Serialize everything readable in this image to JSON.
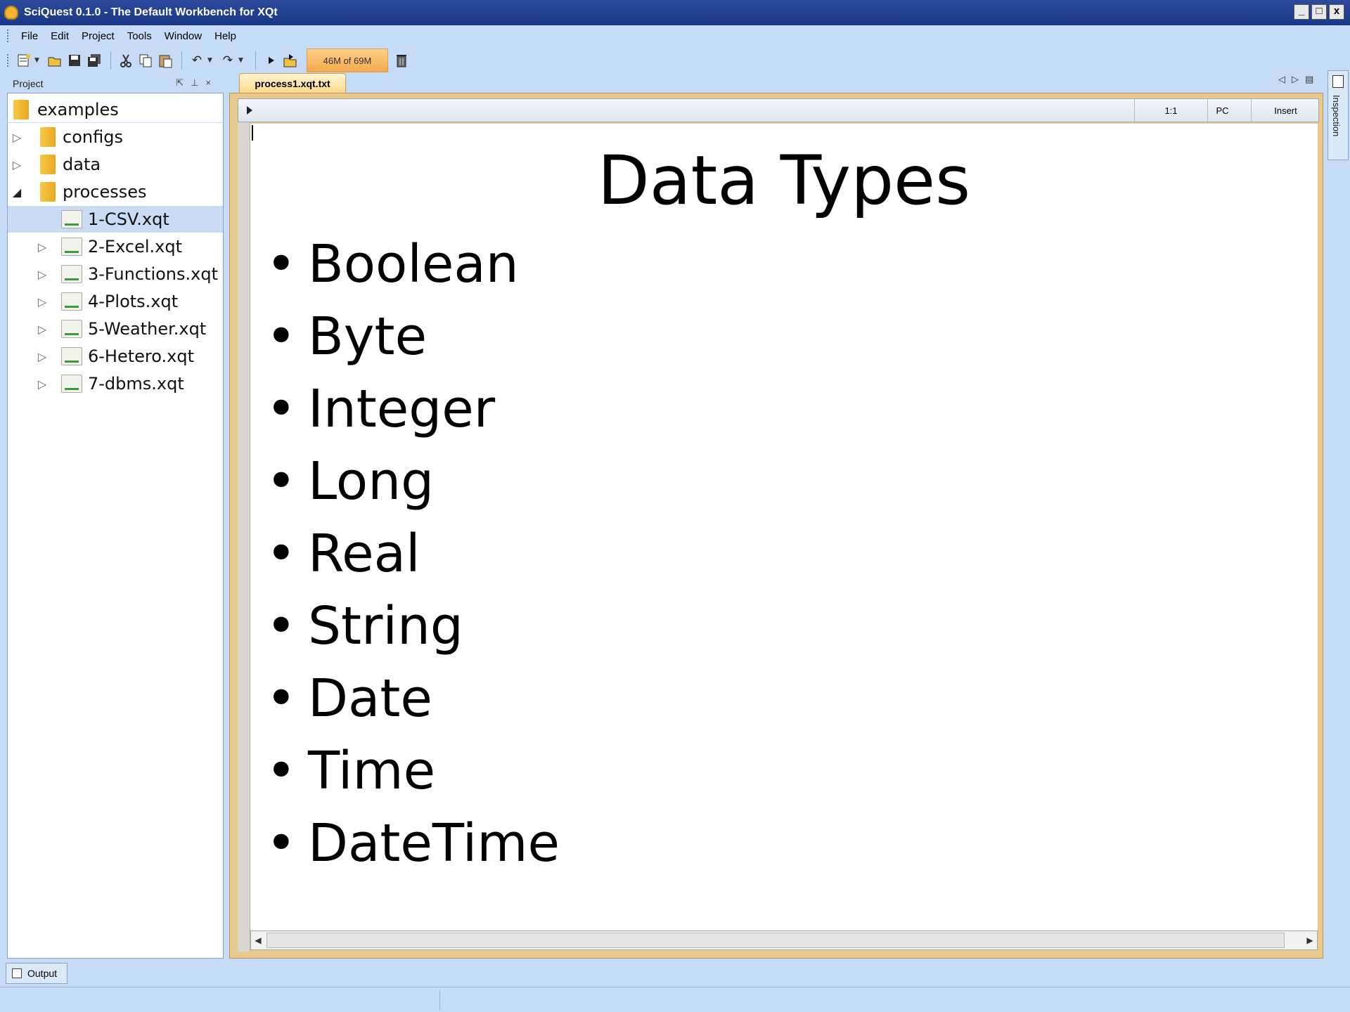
{
  "window": {
    "title": "SciQuest 0.1.0 - The Default Workbench for XQt",
    "controls": [
      "_",
      "□",
      "x"
    ]
  },
  "menu": [
    "File",
    "Edit",
    "Project",
    "Tools",
    "Window",
    "Help"
  ],
  "toolbar": {
    "memory": "46M of 69M",
    "icons": [
      "new-icon",
      "open-icon",
      "save-icon",
      "save-all-icon",
      "cut-icon",
      "copy-icon",
      "paste-icon",
      "undo-icon",
      "redo-icon",
      "run-icon",
      "debug-icon",
      "garbage-collect-icon"
    ]
  },
  "project_panel": {
    "title": "Project",
    "root": "examples",
    "folders": [
      "configs",
      "data",
      "processes"
    ],
    "files": [
      "1-CSV.xqt",
      "2-Excel.xqt",
      "3-Functions.xqt",
      "4-Plots.xqt",
      "5-Weather.xqt",
      "6-Hetero.xqt",
      "7-dbms.xqt"
    ],
    "selected_file": "1-CSV.xqt"
  },
  "editor": {
    "tab_label": "process1.xqt.txt",
    "status": {
      "position": "1:1",
      "line_ending": "PC",
      "mode": "Insert"
    }
  },
  "slide": {
    "title": "Data Types",
    "items": [
      "Boolean",
      "Byte",
      "Integer",
      "Long",
      "Real",
      "String",
      "Date",
      "Time",
      "DateTime"
    ]
  },
  "side_panel": {
    "inspection_label": "Inspection"
  },
  "bottom": {
    "output_tab": "Output"
  }
}
